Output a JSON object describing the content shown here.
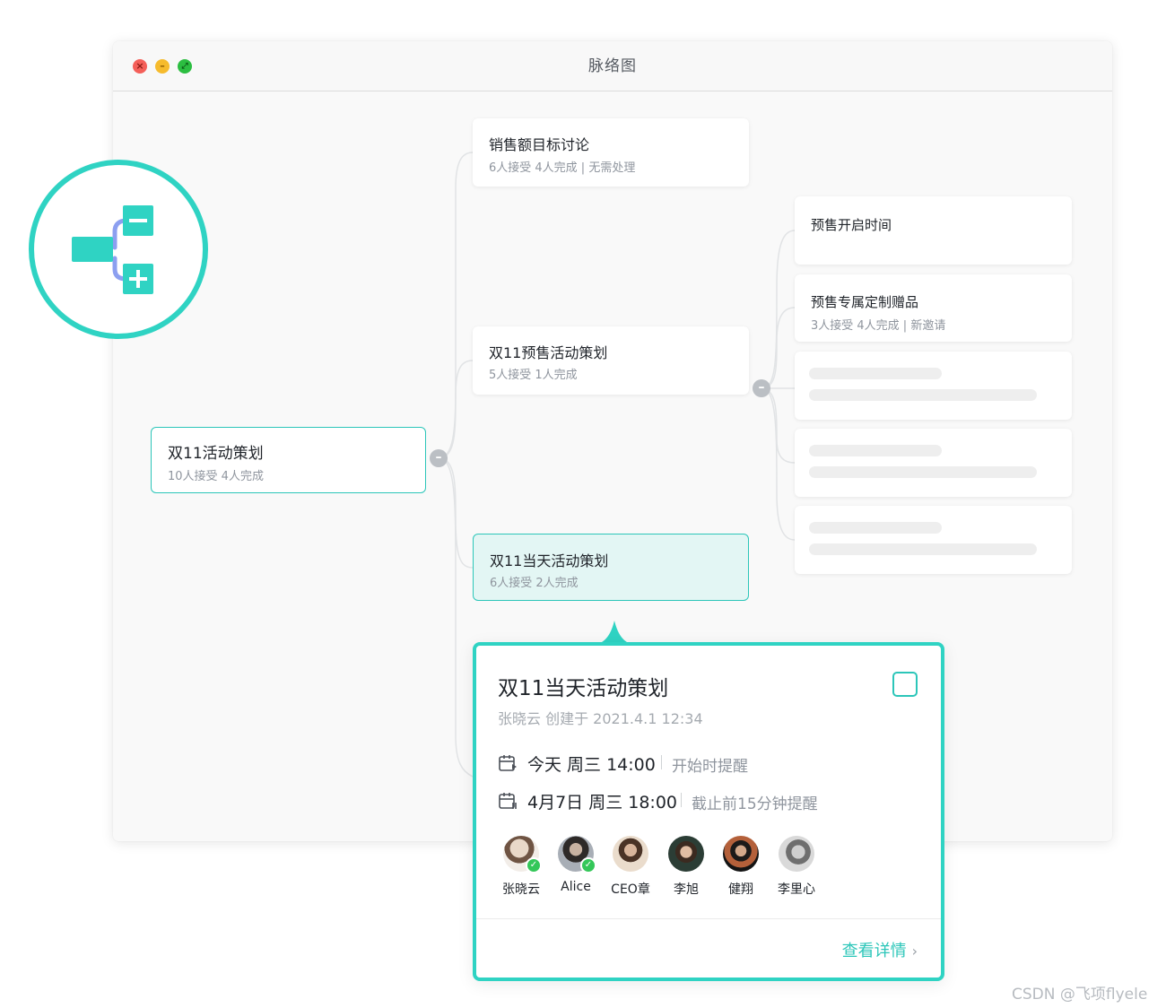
{
  "window": {
    "title": "脉络图",
    "controls": {
      "close": "×",
      "minimize": "–",
      "maximize": "⤢"
    }
  },
  "mindmap": {
    "root": {
      "title": "双11活动策划",
      "meta": "10人接受 4人完成"
    },
    "branches": [
      {
        "title": "销售额目标讨论",
        "meta": "6人接受 4人完成 | 无需处理"
      },
      {
        "title": "双11预售活动策划",
        "meta": "5人接受 1人完成"
      },
      {
        "title": "双11当天活动策划",
        "meta": "6人接受 2人完成"
      }
    ],
    "sub_branches": [
      {
        "title": "预售开启时间"
      },
      {
        "title": "预售专属定制赠品",
        "meta": "3人接受 4人完成 | 新邀请"
      }
    ],
    "collapse_symbol": "–"
  },
  "popup": {
    "title": "双11当天活动策划",
    "creator": "张晓云 创建于 2021.4.1 12:34",
    "start": {
      "time": "今天 周三 14:00",
      "remind": "开始时提醒"
    },
    "end": {
      "time": "4月7日 周三 18:00",
      "remind": "截止前15分钟提醒"
    },
    "members": [
      {
        "name": "张晓云",
        "done": true
      },
      {
        "name": "Alice",
        "done": true
      },
      {
        "name": "CEO章",
        "done": false
      },
      {
        "name": "李旭",
        "done": false
      },
      {
        "name": "健翔",
        "done": false
      },
      {
        "name": "李里心",
        "done": false
      }
    ],
    "check_symbol": "✓",
    "details_link": "查看详情",
    "chevron": "›"
  },
  "watermark": "CSDN @飞项flyele",
  "colors": {
    "accent": "#2cc6b9",
    "logo_teal": "#2fd3c3",
    "logo_line": "#8c9ff0"
  },
  "icons": [
    "mindmap-logo-icon",
    "calendar-start-icon",
    "calendar-end-icon",
    "collapse-icon",
    "chevron-right-icon"
  ]
}
